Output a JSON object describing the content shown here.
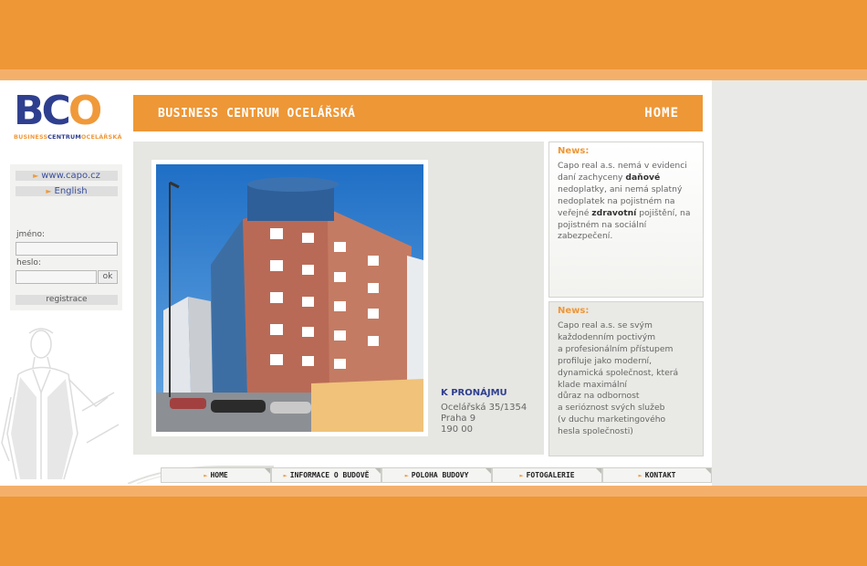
{
  "logo": {
    "big": [
      "B",
      "C",
      "O"
    ],
    "small": [
      "BUSINESS",
      "CENTRUM",
      "OCELÁŘSKÁ"
    ]
  },
  "left": {
    "links": [
      {
        "label": "www.capo.cz"
      },
      {
        "label": "English"
      }
    ],
    "username_label": "jméno:",
    "password_label": "heslo:",
    "ok_label": "ok",
    "register_label": "registrace"
  },
  "header": {
    "title": "BUSINESS CENTRUM OCELÁŘSKÁ",
    "home": "HOME"
  },
  "rent": {
    "title": "K PRONÁJMU",
    "address": [
      "Ocelářská 35/1354",
      "Praha 9",
      "190 00"
    ]
  },
  "news": [
    {
      "title": "News:"
    },
    {
      "title": "News:"
    }
  ],
  "nav": [
    "HOME",
    "INFORMACE O BUDOVĚ",
    "POLOHA BUDOVY",
    "FOTOGALERIE",
    "KONTAKT"
  ],
  "colors": {
    "orange": "#ee9736",
    "navy": "#2f3f8f",
    "gray_bg": "#e6e6e2"
  },
  "icons": {
    "bullet": "orange-arrow-icon"
  }
}
